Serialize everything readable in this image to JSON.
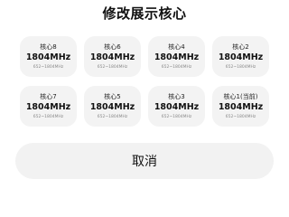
{
  "dialog": {
    "title": "修改展示核心",
    "cores": [
      {
        "name": "核心8",
        "freq": "1804MHz",
        "range": "652~1804MHz"
      },
      {
        "name": "核心6",
        "freq": "1804MHz",
        "range": "652~1804MHz"
      },
      {
        "name": "核心4",
        "freq": "1804MHz",
        "range": "652~1804MHz"
      },
      {
        "name": "核心2",
        "freq": "1804MHz",
        "range": "652~1804MHz"
      },
      {
        "name": "核心7",
        "freq": "1804MHz",
        "range": "652~1804MHz"
      },
      {
        "name": "核心5",
        "freq": "1804MHz",
        "range": "652~1804MHz"
      },
      {
        "name": "核心3",
        "freq": "1804MHz",
        "range": "652~1804MHz"
      },
      {
        "name": "核心1(当前)",
        "freq": "1804MHz",
        "range": "652~1804MHz"
      }
    ],
    "cancel_label": "取消"
  }
}
